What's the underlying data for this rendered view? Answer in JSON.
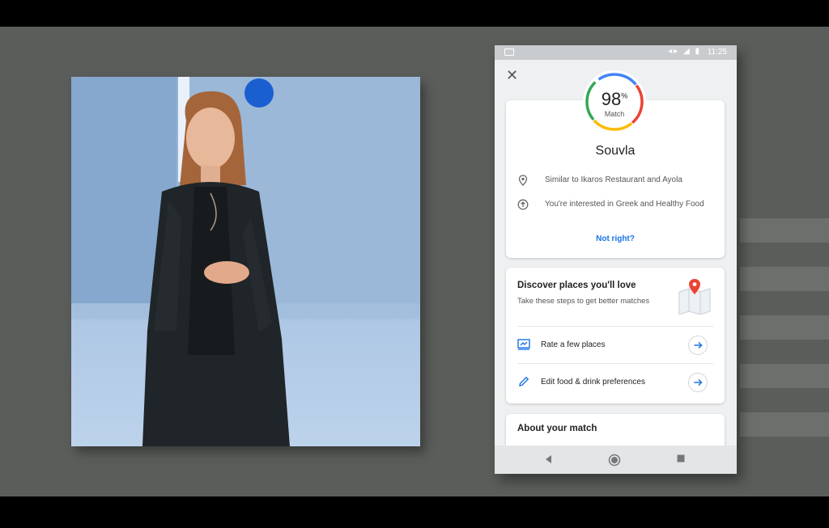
{
  "statusbar": {
    "time": "11:25",
    "icons": "◂▸ ◢ ▮"
  },
  "close_label": "✕",
  "match": {
    "value": "98",
    "unit": "%",
    "label": "Match",
    "fraction": 0.98
  },
  "place_name": "Souvla",
  "reasons": [
    {
      "icon": "location-pin-icon",
      "text": "Similar to Ikaros Restaurant and Ayola"
    },
    {
      "icon": "arrow-up-circle-icon",
      "text": "You're interested in Greek and Healthy Food"
    }
  ],
  "not_right": "Not right?",
  "discover": {
    "title": "Discover places you'll love",
    "subtitle": "Take these steps to get better matches",
    "actions": [
      {
        "icon": "rate-icon",
        "label": "Rate a few places"
      },
      {
        "icon": "pencil-icon",
        "label": "Edit food & drink preferences"
      }
    ]
  },
  "about": {
    "title": "About your match",
    "partial_text": ""
  },
  "colors": {
    "ring": [
      "#4285f4",
      "#ea4335",
      "#fbbc05",
      "#34a853"
    ],
    "link": "#1a73e8",
    "stage": "#5b5d5b"
  }
}
